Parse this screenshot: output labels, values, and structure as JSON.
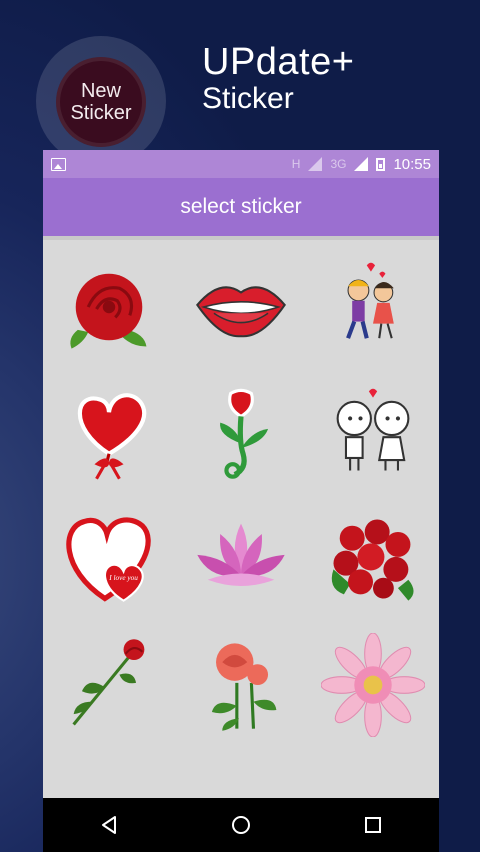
{
  "promo": {
    "badge_line1": "New",
    "badge_line2": "Sticker",
    "headline_line1": "UPdate+",
    "headline_line2": "Sticker"
  },
  "status_bar": {
    "net1": "H",
    "net2": "3G",
    "time": "10:55"
  },
  "app_bar": {
    "title": "select sticker"
  },
  "stickers": [
    {
      "icon": "red-rose-icon"
    },
    {
      "icon": "lips-icon"
    },
    {
      "icon": "kissing-couple-icon"
    },
    {
      "icon": "heart-balloon-icon"
    },
    {
      "icon": "tulip-icon"
    },
    {
      "icon": "cartoon-couple-icon"
    },
    {
      "icon": "i-love-you-heart-icon",
      "text": "I love you"
    },
    {
      "icon": "lotus-icon"
    },
    {
      "icon": "rose-bouquet-icon"
    },
    {
      "icon": "single-rose-icon"
    },
    {
      "icon": "pink-roses-icon"
    },
    {
      "icon": "pink-gerbera-icon"
    }
  ],
  "colors": {
    "status_bar": "#ae86d6",
    "app_bar": "#9b6fd0",
    "content_bg": "#d9d9d9",
    "badge": "#3a0c1f",
    "background": "#15234e"
  }
}
